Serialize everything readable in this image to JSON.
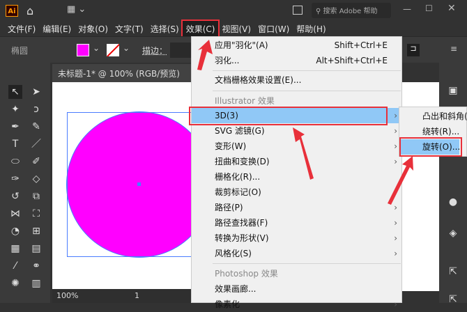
{
  "app": {
    "logo": "Ai",
    "search_placeholder": "搜索 Adobe 帮助"
  },
  "menubar": [
    "文件(F)",
    "编辑(E)",
    "对象(O)",
    "文字(T)",
    "选择(S)",
    "效果(C)",
    "视图(V)",
    "窗口(W)",
    "帮助(H)"
  ],
  "control": {
    "object_type": "椭圆",
    "stroke_label": "描边："
  },
  "document": {
    "tab_title": "未标题-1* @ 100% (RGB/预览)",
    "zoom": "100%",
    "artboard": "1",
    "fill_color": "#ff00ff"
  },
  "effect_menu": {
    "apply": {
      "label": "应用\"羽化\"(A)",
      "shortcut": "Shift+Ctrl+E"
    },
    "feather": {
      "label": "羽化...",
      "shortcut": "Alt+Shift+Ctrl+E"
    },
    "raster_settings": "文档栅格效果设置(E)...",
    "illustrator_header": "Illustrator 效果",
    "illustrator_items": [
      "3D(3)",
      "SVG 滤镜(G)",
      "变形(W)",
      "扭曲和变换(D)",
      "栅格化(R)...",
      "裁剪标记(O)",
      "路径(P)",
      "路径查找器(F)",
      "转换为形状(V)",
      "风格化(S)"
    ],
    "photoshop_header": "Photoshop 效果",
    "photoshop_items": [
      "效果画廊...",
      "像素化"
    ]
  },
  "submenu_3d": [
    "凸出和斜角(",
    "绕转(R)...",
    "旋转(O)..."
  ]
}
